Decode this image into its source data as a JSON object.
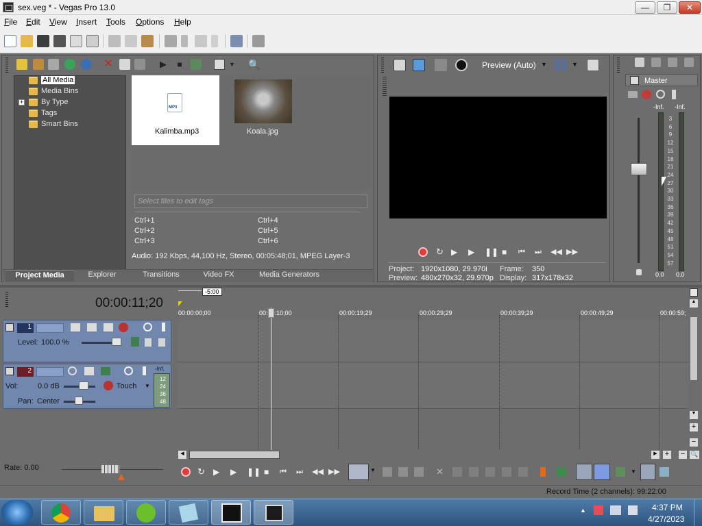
{
  "window": {
    "title": "sex.veg * - Vegas Pro 13.0",
    "min_glyph": "—",
    "max_glyph": "❐",
    "close_glyph": "✕"
  },
  "menu": [
    "File",
    "Edit",
    "View",
    "Insert",
    "Tools",
    "Options",
    "Help"
  ],
  "media": {
    "tree": [
      "All Media",
      "Media Bins",
      "By Type",
      "Tags",
      "Smart Bins"
    ],
    "expand_glyph": "+",
    "files": [
      "Kalimba.mp3",
      "Koala.jpg"
    ],
    "mp3_badge": "MP3",
    "tag_placeholder": "Select files to edit tags",
    "shortcuts": [
      "Ctrl+1",
      "Ctrl+2",
      "Ctrl+3",
      "Ctrl+4",
      "Ctrl+5",
      "Ctrl+6"
    ],
    "info": "Audio: 192 Kbps, 44,100 Hz, Stereo, 00:05:48;01, MPEG Layer-3",
    "tabs": [
      "Project Media",
      "Explorer",
      "Transitions",
      "Video FX",
      "Media Generators"
    ]
  },
  "preview": {
    "mode": "Preview (Auto)",
    "project_label": "Project:",
    "project_value": "1920x1080, 29.970i",
    "frame_label": "Frame:",
    "frame_value": "350",
    "preview_label": "Preview:",
    "preview_value": "480x270x32, 29.970p",
    "display_label": "Display:",
    "display_value": "317x178x32"
  },
  "master": {
    "label": "Master",
    "peak_left": "-Inf.",
    "peak_right": "-Inf.",
    "scale": [
      "3",
      "6",
      "9",
      "12",
      "15",
      "18",
      "21",
      "24",
      "27",
      "30",
      "33",
      "36",
      "39",
      "42",
      "45",
      "48",
      "51",
      "54",
      "57"
    ],
    "bottom_left": "0.0",
    "bottom_right": "0.0"
  },
  "timeline": {
    "timecode": "00:00:11;20",
    "marker": "-5:00",
    "ruler": [
      "00:00:00;00",
      "00:00:10;00",
      "00:00:19;29",
      "00:00:29;29",
      "00:00:39;29",
      "00:00:49;29",
      "00:00:59;"
    ]
  },
  "tracks": {
    "video": {
      "number": "1",
      "level_label": "Level:",
      "level_value": "100.0 %"
    },
    "audio": {
      "number": "2",
      "vol_label": "Vol:",
      "vol_value": "0.0 dB",
      "pan_label": "Pan:",
      "pan_value": "Center",
      "automation": "Touch",
      "peak": "-Inf.",
      "meter": [
        "12",
        "24",
        "36",
        "48"
      ]
    }
  },
  "transport": {
    "rate": "Rate: 0.00"
  },
  "status": {
    "record_time": "Record Time (2 channels): 99:22:00"
  },
  "taskbar": {
    "time": "4:37 PM",
    "date": "4/27/2023"
  },
  "colors": {
    "accent_record": "#e03a3a",
    "track_header": "#7287ad",
    "taskbar": "#3b6695"
  }
}
